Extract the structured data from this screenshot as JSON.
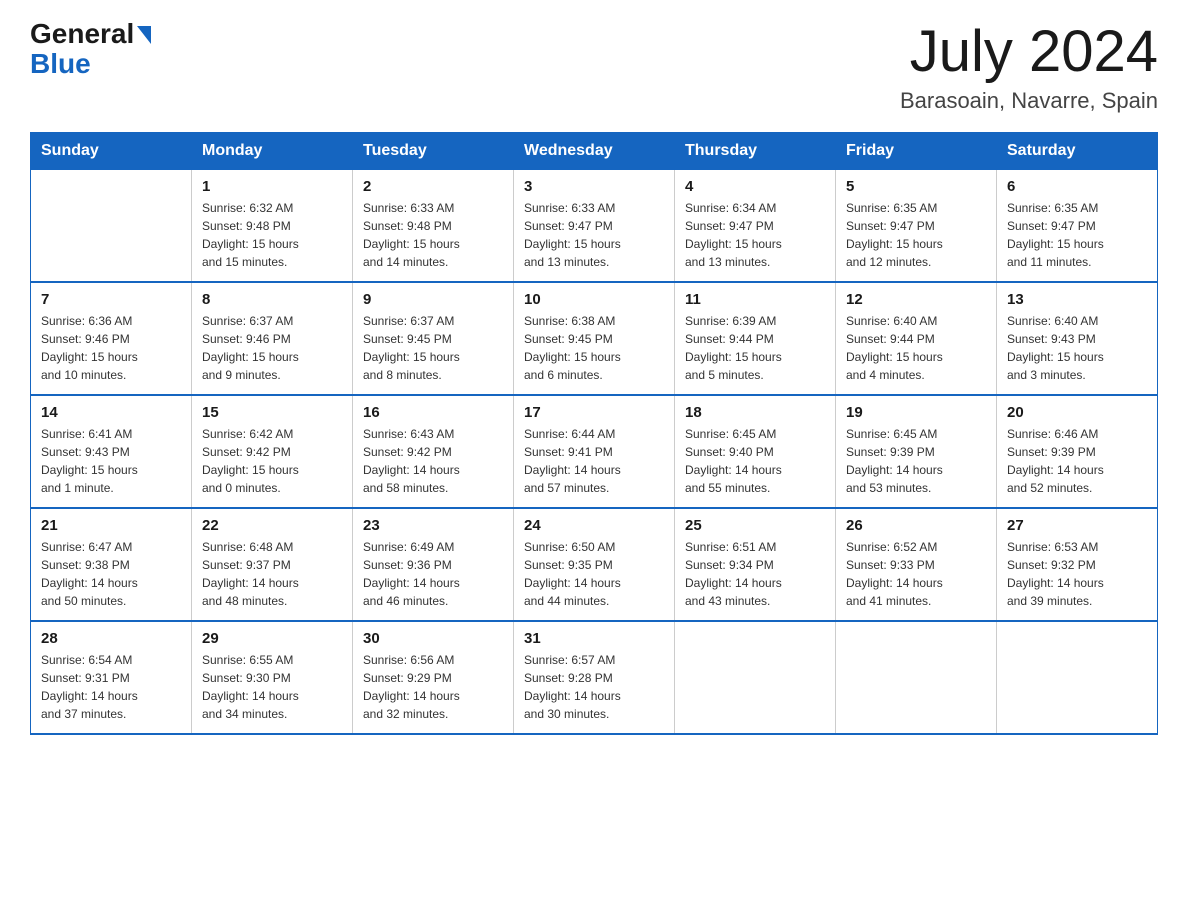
{
  "logo": {
    "general": "General",
    "blue": "Blue"
  },
  "title": "July 2024",
  "subtitle": "Barasoain, Navarre, Spain",
  "weekdays": [
    "Sunday",
    "Monday",
    "Tuesday",
    "Wednesday",
    "Thursday",
    "Friday",
    "Saturday"
  ],
  "weeks": [
    [
      {
        "day": "",
        "info": ""
      },
      {
        "day": "1",
        "info": "Sunrise: 6:32 AM\nSunset: 9:48 PM\nDaylight: 15 hours\nand 15 minutes."
      },
      {
        "day": "2",
        "info": "Sunrise: 6:33 AM\nSunset: 9:48 PM\nDaylight: 15 hours\nand 14 minutes."
      },
      {
        "day": "3",
        "info": "Sunrise: 6:33 AM\nSunset: 9:47 PM\nDaylight: 15 hours\nand 13 minutes."
      },
      {
        "day": "4",
        "info": "Sunrise: 6:34 AM\nSunset: 9:47 PM\nDaylight: 15 hours\nand 13 minutes."
      },
      {
        "day": "5",
        "info": "Sunrise: 6:35 AM\nSunset: 9:47 PM\nDaylight: 15 hours\nand 12 minutes."
      },
      {
        "day": "6",
        "info": "Sunrise: 6:35 AM\nSunset: 9:47 PM\nDaylight: 15 hours\nand 11 minutes."
      }
    ],
    [
      {
        "day": "7",
        "info": "Sunrise: 6:36 AM\nSunset: 9:46 PM\nDaylight: 15 hours\nand 10 minutes."
      },
      {
        "day": "8",
        "info": "Sunrise: 6:37 AM\nSunset: 9:46 PM\nDaylight: 15 hours\nand 9 minutes."
      },
      {
        "day": "9",
        "info": "Sunrise: 6:37 AM\nSunset: 9:45 PM\nDaylight: 15 hours\nand 8 minutes."
      },
      {
        "day": "10",
        "info": "Sunrise: 6:38 AM\nSunset: 9:45 PM\nDaylight: 15 hours\nand 6 minutes."
      },
      {
        "day": "11",
        "info": "Sunrise: 6:39 AM\nSunset: 9:44 PM\nDaylight: 15 hours\nand 5 minutes."
      },
      {
        "day": "12",
        "info": "Sunrise: 6:40 AM\nSunset: 9:44 PM\nDaylight: 15 hours\nand 4 minutes."
      },
      {
        "day": "13",
        "info": "Sunrise: 6:40 AM\nSunset: 9:43 PM\nDaylight: 15 hours\nand 3 minutes."
      }
    ],
    [
      {
        "day": "14",
        "info": "Sunrise: 6:41 AM\nSunset: 9:43 PM\nDaylight: 15 hours\nand 1 minute."
      },
      {
        "day": "15",
        "info": "Sunrise: 6:42 AM\nSunset: 9:42 PM\nDaylight: 15 hours\nand 0 minutes."
      },
      {
        "day": "16",
        "info": "Sunrise: 6:43 AM\nSunset: 9:42 PM\nDaylight: 14 hours\nand 58 minutes."
      },
      {
        "day": "17",
        "info": "Sunrise: 6:44 AM\nSunset: 9:41 PM\nDaylight: 14 hours\nand 57 minutes."
      },
      {
        "day": "18",
        "info": "Sunrise: 6:45 AM\nSunset: 9:40 PM\nDaylight: 14 hours\nand 55 minutes."
      },
      {
        "day": "19",
        "info": "Sunrise: 6:45 AM\nSunset: 9:39 PM\nDaylight: 14 hours\nand 53 minutes."
      },
      {
        "day": "20",
        "info": "Sunrise: 6:46 AM\nSunset: 9:39 PM\nDaylight: 14 hours\nand 52 minutes."
      }
    ],
    [
      {
        "day": "21",
        "info": "Sunrise: 6:47 AM\nSunset: 9:38 PM\nDaylight: 14 hours\nand 50 minutes."
      },
      {
        "day": "22",
        "info": "Sunrise: 6:48 AM\nSunset: 9:37 PM\nDaylight: 14 hours\nand 48 minutes."
      },
      {
        "day": "23",
        "info": "Sunrise: 6:49 AM\nSunset: 9:36 PM\nDaylight: 14 hours\nand 46 minutes."
      },
      {
        "day": "24",
        "info": "Sunrise: 6:50 AM\nSunset: 9:35 PM\nDaylight: 14 hours\nand 44 minutes."
      },
      {
        "day": "25",
        "info": "Sunrise: 6:51 AM\nSunset: 9:34 PM\nDaylight: 14 hours\nand 43 minutes."
      },
      {
        "day": "26",
        "info": "Sunrise: 6:52 AM\nSunset: 9:33 PM\nDaylight: 14 hours\nand 41 minutes."
      },
      {
        "day": "27",
        "info": "Sunrise: 6:53 AM\nSunset: 9:32 PM\nDaylight: 14 hours\nand 39 minutes."
      }
    ],
    [
      {
        "day": "28",
        "info": "Sunrise: 6:54 AM\nSunset: 9:31 PM\nDaylight: 14 hours\nand 37 minutes."
      },
      {
        "day": "29",
        "info": "Sunrise: 6:55 AM\nSunset: 9:30 PM\nDaylight: 14 hours\nand 34 minutes."
      },
      {
        "day": "30",
        "info": "Sunrise: 6:56 AM\nSunset: 9:29 PM\nDaylight: 14 hours\nand 32 minutes."
      },
      {
        "day": "31",
        "info": "Sunrise: 6:57 AM\nSunset: 9:28 PM\nDaylight: 14 hours\nand 30 minutes."
      },
      {
        "day": "",
        "info": ""
      },
      {
        "day": "",
        "info": ""
      },
      {
        "day": "",
        "info": ""
      }
    ]
  ]
}
